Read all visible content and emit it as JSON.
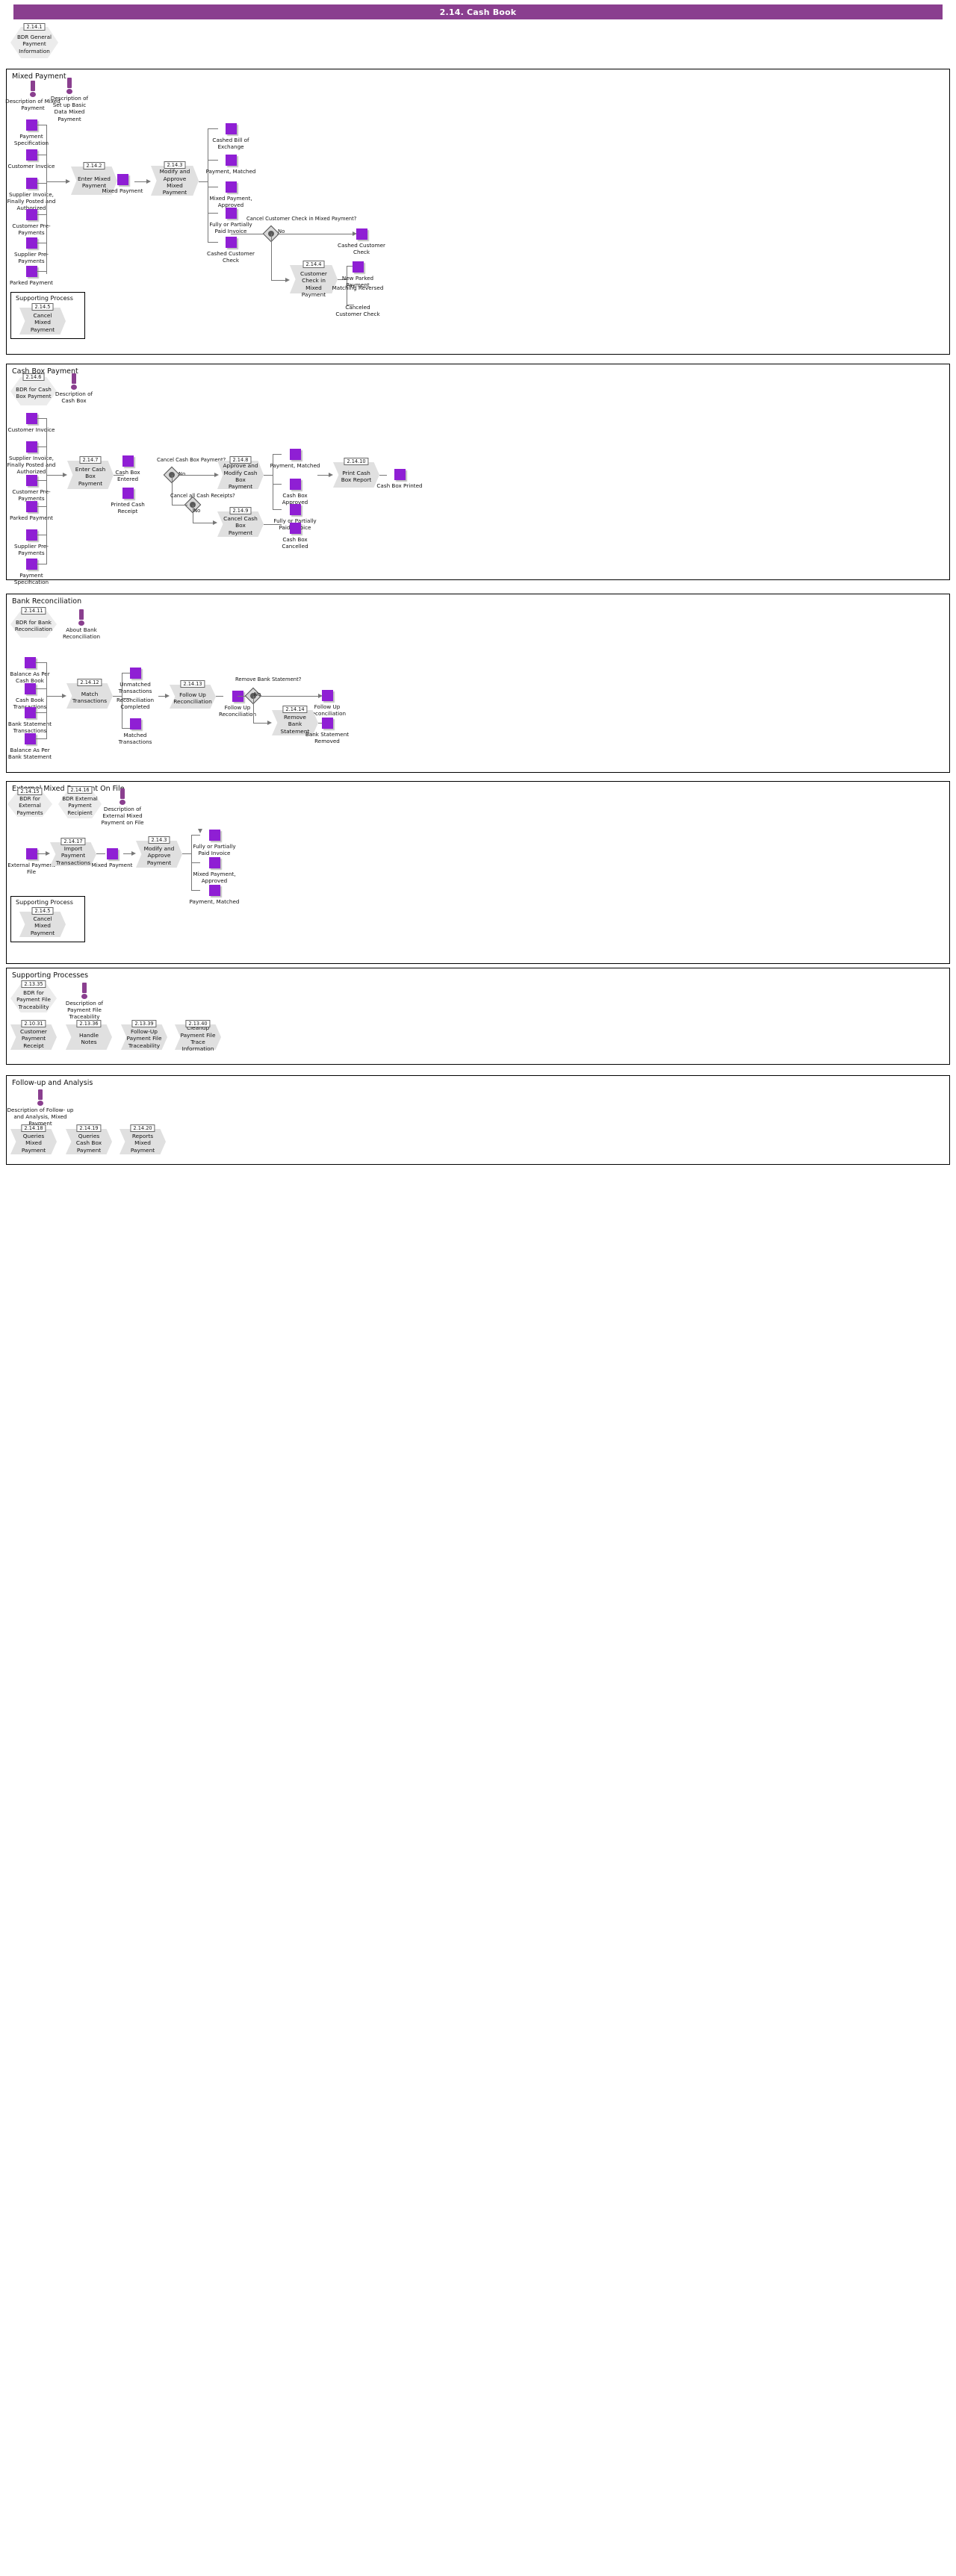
{
  "header": {
    "title": "2.14. Cash Book",
    "accent": "#8a3f8f"
  },
  "top": {
    "bdr": {
      "num": "2.14.1",
      "label": "BDR General Payment Information"
    }
  },
  "sections": [
    {
      "key": "mixed_payment",
      "label": "Mixed Payment",
      "notes": [
        {
          "label": "Description of Mixed Payment"
        },
        {
          "label": "Description of Set up Basic Data Mixed Payment"
        }
      ],
      "inputs": [
        {
          "label": "Payment Specification"
        },
        {
          "label": "Customer Invoice"
        },
        {
          "label": "Supplier Invoice, Finally Posted and Authorized"
        },
        {
          "label": "Customer Pre-Payments"
        },
        {
          "label": "Supplier Pre-Payments"
        },
        {
          "label": "Parked Payment"
        }
      ],
      "activities": [
        {
          "num": "2.14.2",
          "label": "Enter Mixed Payment"
        },
        {
          "num": "2.14.3",
          "label": "Modify and Approve Mixed Payment"
        },
        {
          "num": "2.14.4",
          "label": "Cancel Customer Check in Mixed Payment"
        }
      ],
      "mid_object": {
        "label": "Mixed Payment"
      },
      "outputs": [
        {
          "label": "Cashed Bill of Exchange"
        },
        {
          "label": "Payment, Matched"
        },
        {
          "label": "Mixed Payment, Approved"
        },
        {
          "label": "Fully or Partially Paid Invoice"
        },
        {
          "label": "Cashed Customer Check"
        }
      ],
      "gateway": {
        "question": "Cancel Customer Check in Mixed Payment?",
        "no": "No"
      },
      "far_outputs": [
        {
          "label": "Cashed Customer Check"
        },
        {
          "label": "New Parked Payment"
        },
        {
          "label": "Matching Reversed"
        },
        {
          "label": "Canceled Customer Check"
        }
      ],
      "supporting": {
        "label": "Supporting Process",
        "items": [
          {
            "num": "2.14.5",
            "label": "Cancel Mixed Payment"
          }
        ]
      }
    },
    {
      "key": "cash_box_payment",
      "label": "Cash Box Payment",
      "bdr": {
        "num": "2.14.6",
        "label": "BDR for Cash Box Payment"
      },
      "notes": [
        {
          "label": "Description of Cash Box"
        }
      ],
      "inputs": [
        {
          "label": "Customer Invoice"
        },
        {
          "label": "Supplier Invoice, Finally Posted and Authorized"
        },
        {
          "label": "Customer Pre-Payments"
        },
        {
          "label": "Parked Payment"
        },
        {
          "label": "Supplier Pre-Payments"
        },
        {
          "label": "Payment Specification"
        }
      ],
      "activities": [
        {
          "num": "2.14.7",
          "label": "Enter Cash Box Payment"
        },
        {
          "num": "2.14.8",
          "label": "Approve and Modify Cash Box Payment"
        },
        {
          "num": "2.14.9",
          "label": "Cancel Cash Box Payment"
        },
        {
          "num": "2.14.10",
          "label": "Print Cash Box Report"
        }
      ],
      "mid_objects": [
        {
          "label": "Cash Box Entered"
        },
        {
          "label": "Printed Cash Receipt"
        },
        {
          "label": "Payment, Matched"
        },
        {
          "label": "Cash Box Approved"
        },
        {
          "label": "Fully or Partially Paid Invoice"
        },
        {
          "label": "Cash Box Cancelled"
        },
        {
          "label": "Cash Box Printed"
        }
      ],
      "gateways": [
        {
          "question": "Cancel Cash Box Payment?",
          "no": "No"
        },
        {
          "question": "Cancel all Cash Receipts?",
          "no": "No"
        }
      ]
    },
    {
      "key": "bank_reconciliation",
      "label": "Bank Reconciliation",
      "bdr": {
        "num": "2.14.11",
        "label": "BDR for Bank Reconciliation"
      },
      "notes": [
        {
          "label": "About Bank Reconciliation"
        }
      ],
      "inputs": [
        {
          "label": "Balance As Per Cash Book"
        },
        {
          "label": "Cash Book Transactions"
        },
        {
          "label": "Bank Statement Transactions"
        },
        {
          "label": "Balance As Per Bank Statement"
        }
      ],
      "activities": [
        {
          "num": "2.14.12",
          "label": "Match Transactions"
        },
        {
          "num": "2.14.13",
          "label": "Follow Up Reconciliation"
        },
        {
          "num": "2.14.14",
          "label": "Remove Bank Statement"
        }
      ],
      "mid_objects": [
        {
          "label": "Unmatched Transactions"
        },
        {
          "label": "Reconciliation Completed"
        },
        {
          "label": "Matched Transactions"
        },
        {
          "label": "Follow Up Reconciliation"
        },
        {
          "label": "Follow Up Reconciliation"
        },
        {
          "label": "Bank Statement Removed"
        }
      ],
      "gateway": {
        "question": "Remove Bank Statement?",
        "no": "No"
      }
    },
    {
      "key": "external_mixed_payment_on_file",
      "label": "External Mixed Payment On File",
      "bdr": {
        "num": "2.14.15",
        "label": "BDR for External Payments"
      },
      "bdr2": {
        "num": "2.14.16",
        "label": "BDR External Payment Recipient"
      },
      "notes": [
        {
          "label": "Description of External Mixed Payment on File"
        }
      ],
      "inputs": [
        {
          "label": "External Payment File"
        }
      ],
      "activities": [
        {
          "num": "2.14.17",
          "label": "Import Payment Transactions"
        },
        {
          "num": "2.14.3",
          "label": "Modify and Approve Payment"
        }
      ],
      "mid_objects": [
        {
          "label": "Mixed Payment"
        },
        {
          "label": "Fully or Partially Paid Invoice"
        },
        {
          "label": "Mixed Payment, Approved"
        },
        {
          "label": "Payment, Matched"
        }
      ],
      "supporting": {
        "label": "Supporting Process",
        "items": [
          {
            "num": "2.14.5",
            "label": "Cancel Mixed Payment"
          }
        ]
      }
    },
    {
      "key": "supporting_processes",
      "label": "Supporting Processes",
      "bdr": {
        "num": "2.13.35",
        "label": "BDR for Payment File Traceability"
      },
      "notes": [
        {
          "label": "Description of Payment File Traceability"
        }
      ],
      "activities": [
        {
          "num": "2.10.31",
          "label": "Customer Payment Receipt"
        },
        {
          "num": "2.13.36",
          "label": "Handle Notes"
        },
        {
          "num": "2.13.39",
          "label": "Follow-Up Payment File Traceability"
        },
        {
          "num": "2.13.40",
          "label": "Cleanup Payment File Trace Information"
        }
      ]
    },
    {
      "key": "follow_up_and_analysis",
      "label": "Follow-up and Analysis",
      "notes": [
        {
          "label": "Description of Follow- up and Analysis, Mixed Payment"
        }
      ],
      "activities": [
        {
          "num": "2.14.18",
          "label": "Queries Mixed Payment"
        },
        {
          "num": "2.14.19",
          "label": "Queries Cash Box Payment"
        },
        {
          "num": "2.14.20",
          "label": "Reports Mixed Payment"
        }
      ]
    }
  ]
}
